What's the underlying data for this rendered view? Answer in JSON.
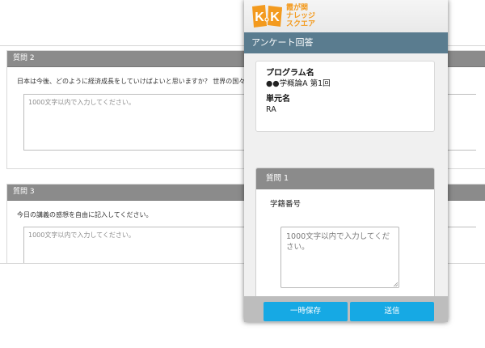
{
  "background_form": {
    "question2": {
      "header": "質問 2",
      "text": "日本は今後、どのように経済成長をしていけばよいと思いますか？ 世界の国々との関係と",
      "placeholder": "1000文字以内で入力してください。"
    },
    "question3": {
      "header": "質問 3",
      "text": "今日の講義の感想を自由に記入してください。",
      "placeholder": "1000文字以内で入力してください。"
    }
  },
  "logo": {
    "line1": "霞が関",
    "line2": "ナレッジ",
    "line3": "スクエア",
    "colors": {
      "orange": "#f39a1e",
      "white": "#ffffff"
    }
  },
  "mobile": {
    "title": "アンケート回答",
    "program_label": "プログラム名",
    "program_value": "●●学概論A 第1回",
    "unit_label": "単元名",
    "unit_value": "RA",
    "question1": {
      "header": "質問 1",
      "label": "学籍番号",
      "placeholder": "1000文字以内で入力してください。"
    },
    "buttons": {
      "save": "一時保存",
      "send": "送信"
    }
  },
  "colors": {
    "title_bar": "#5a7c8f",
    "panel_header": "#8b8b8b",
    "button": "#16a9e4",
    "button_bar": "#bdbdbd"
  }
}
